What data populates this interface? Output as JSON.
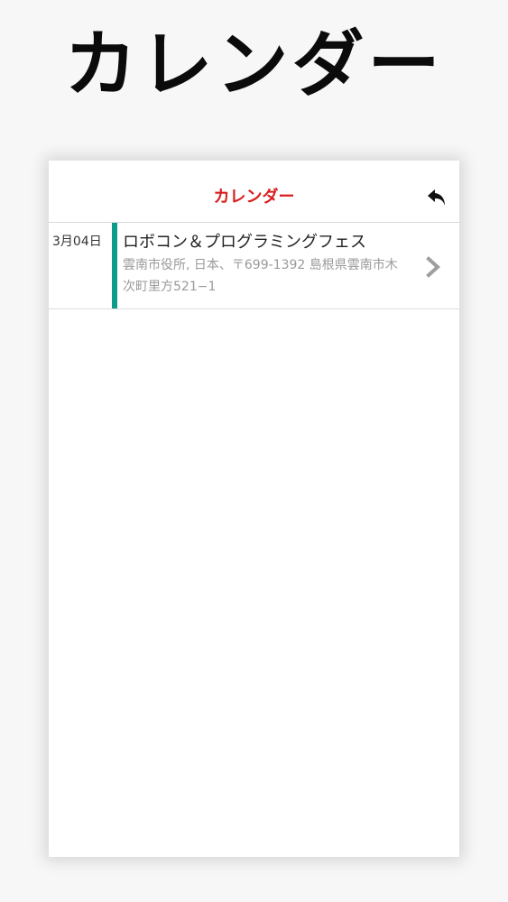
{
  "hero": {
    "title": "カレンダー"
  },
  "nav": {
    "title": "カレンダー",
    "back_icon": "undo-arrow-icon"
  },
  "events": [
    {
      "date": "3月04日",
      "title": "ロボコン＆プログラミングフェス",
      "location": "雲南市役所, 日本、〒699-1392 島根県雲南市木次町里方521−1",
      "accent_color": "#0e9c8a",
      "chevron_icon": "chevron-right-icon"
    }
  ],
  "colors": {
    "nav_title": "#d81e1e",
    "accent": "#0e9c8a"
  }
}
